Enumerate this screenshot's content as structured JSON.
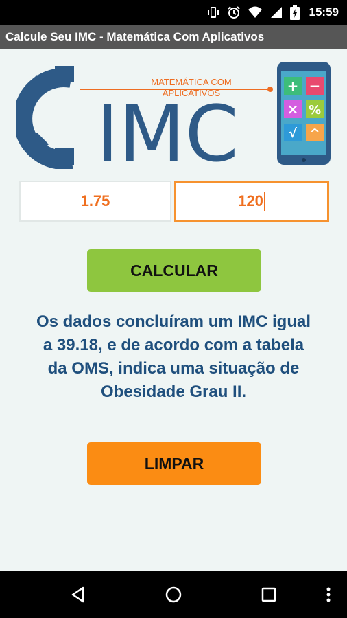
{
  "status_bar": {
    "time": "15:59",
    "icons": [
      "vibrate-icon",
      "alarm-icon",
      "wifi-icon",
      "cell-signal-icon",
      "battery-charging-icon"
    ]
  },
  "app_bar": {
    "title": "Calcule Seu IMC - Matemática Com Aplicativos"
  },
  "logo": {
    "caption_line1": "MATEMÁTICA COM",
    "caption_line2": "APLICATIVOS",
    "word": "IMC",
    "calculator_keys": [
      "+",
      "−",
      "×",
      "%",
      "√",
      "^"
    ]
  },
  "form": {
    "height_value": "1.75",
    "weight_value": "120"
  },
  "buttons": {
    "calculate_label": "CALCULAR",
    "clear_label": "LIMPAR"
  },
  "result": {
    "line1": "Os dados concluíram um IMC igual",
    "line2": "a 39.18, e de acordo com a tabela",
    "line3": "da OMS, indica uma situação de",
    "line4": "Obesidade Grau II."
  },
  "colors": {
    "background": "#eff5f4",
    "accent_orange": "#f6922f",
    "calculate_green": "#8ec63f",
    "clear_orange": "#fb8c13",
    "text_blue": "#1f4f7d",
    "logo_blue": "#2e5a87"
  },
  "nav_bar": {
    "buttons": [
      "back-icon",
      "home-icon",
      "recents-icon",
      "overflow-menu-icon"
    ]
  }
}
